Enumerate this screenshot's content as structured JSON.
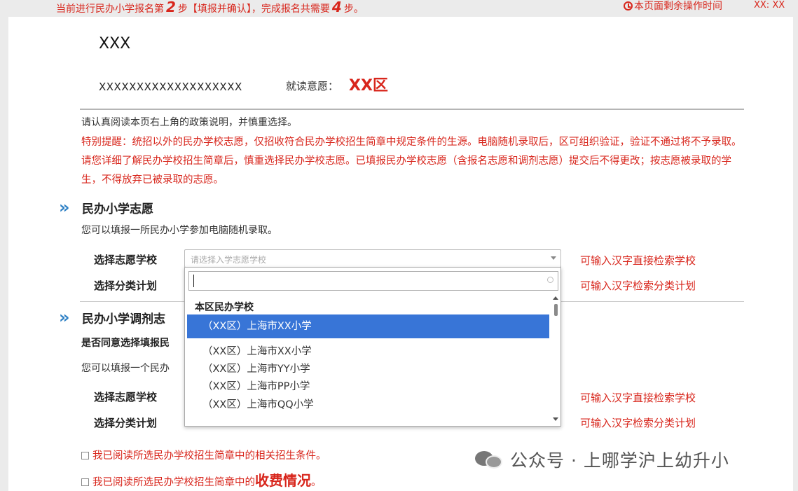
{
  "header": {
    "step_prefix": "当前进行民办小学报名第",
    "current_step": "2",
    "step_mid": "步【填报并确认】，完成报名共需要",
    "total_steps": "4",
    "step_suffix": "步。",
    "timer_label": "本页面剩余操作时间",
    "timer_value": "XX: XX"
  },
  "student": {
    "name": "XXX",
    "id": "XXXXXXXXXXXXXXXXXXX",
    "intent_label": "就读意愿：",
    "intent_value": "XX区"
  },
  "notice": "请认真阅读本页右上角的政策说明，并慎重选择。",
  "warning": "特别提醒：统招以外的民办学校志愿，仅招收符合民办学校招生简章中规定条件的生源。电脑随机录取后，区可组织验证，验证不通过将不予录取。请您详细了解民办学校招生简章后，慎重选择民办学校志愿。已填报民办学校志愿（含报名志愿和调剂志愿）提交后不得更改；按志愿被录取的学生，不得放弃已被录取的志愿。",
  "section1": {
    "arrow": "»",
    "title": "民办小学志愿",
    "desc": "您可以填报一所民办小学参加电脑随机录取。",
    "school_label": "选择志愿学校",
    "school_placeholder": "请选择入学志愿学校",
    "school_hint": "可输入汉字直接检索学校",
    "plan_label": "选择分类计划",
    "plan_hint": "可输入汉字检索分类计划"
  },
  "section2": {
    "arrow": "»",
    "title": "民办小学调剂志",
    "question": "是否同意选择填报民",
    "desc": "您可以填报一个民办",
    "school_label": "选择志愿学校",
    "school_hint": "可输入汉字直接检索学校",
    "plan_label": "选择分类计划",
    "plan_hint": "可输入汉字检索分类计划"
  },
  "dropdown": {
    "search_value": "",
    "group": "本区民办学校",
    "selected_option": "（XX区）上海市XX小学",
    "options": [
      "（XX区）上海市XX小学",
      "（XX区）上海市YY小学",
      "（XX区）上海市PP小学",
      "（XX区）上海市QQ小学"
    ]
  },
  "checkboxes": {
    "c1": "我已阅读所选民办学校招生简章中的相关招生条件。",
    "c2_prefix": "我已阅读所选民办学校招生简章中的",
    "c2_emph": "收费情况",
    "c2_suffix": "。"
  },
  "watermark": {
    "text": "公众号 · 上哪学沪上幼升小"
  },
  "colors": {
    "accent_red": "#d8261c",
    "section_arrow_blue": "#2e80c5",
    "dropdown_selected": "#3875d7"
  }
}
